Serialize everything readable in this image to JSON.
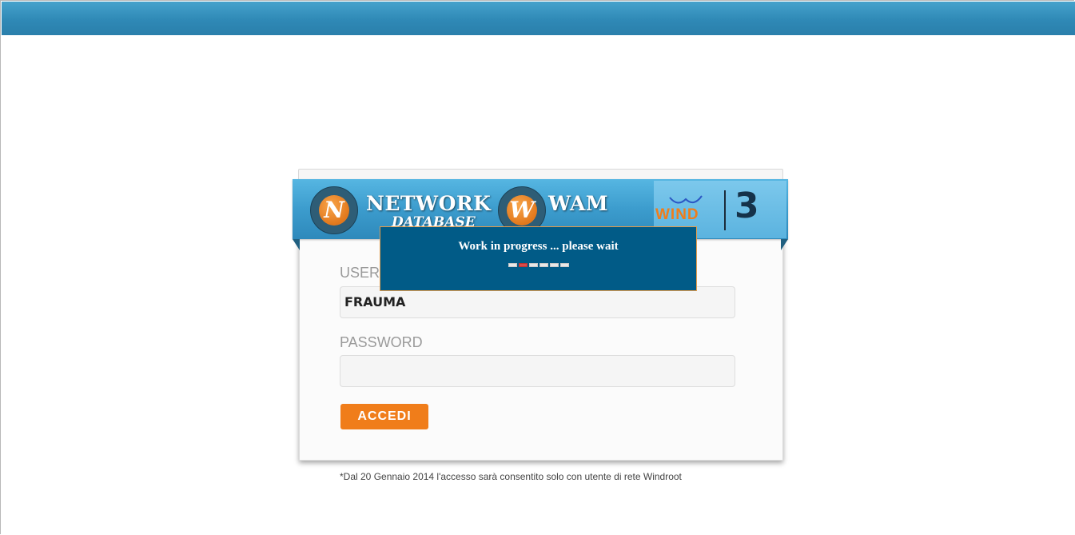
{
  "header": {
    "brand": "NETWORK",
    "brand_sub": "DATABASE",
    "app": "WAM",
    "n_letter": "N",
    "w_letter": "W"
  },
  "partners": {
    "wind": "WIND",
    "three": "3"
  },
  "login": {
    "username_label": "USER",
    "username_value": "FRAUMA",
    "password_label": "PASSWORD",
    "password_value": "",
    "submit_label": "ACCEDI"
  },
  "notice": "*Dal 20 Gennaio 2014 l'accesso sarà consentito solo con utente di rete Windroot",
  "wait_dialog": {
    "message": "Work in progress ... please wait",
    "progress_active_index": 1,
    "progress_segments": 6
  },
  "colors": {
    "accent": "#f07d1a",
    "header": "#2f89b6",
    "dialog": "#015b87"
  }
}
